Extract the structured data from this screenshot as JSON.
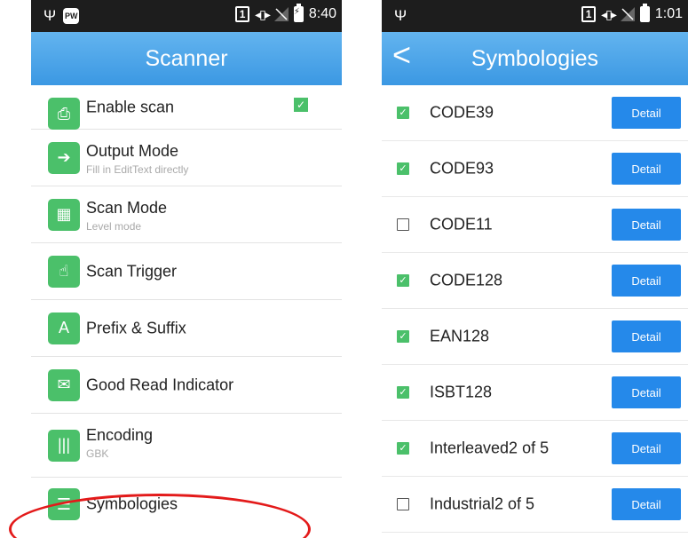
{
  "left": {
    "status": {
      "usb_icon": "usb-icon",
      "notification_icon": "notification-app-icon",
      "sim_badge": "1",
      "time": "8:40"
    },
    "title": "Scanner",
    "items": [
      {
        "title": "Enable scan",
        "subtitle": "",
        "icon": "scan-enable-icon",
        "checked": true
      },
      {
        "title": "Output Mode",
        "subtitle": "Fill in EditText directly",
        "icon": "output-icon"
      },
      {
        "title": "Scan Mode",
        "subtitle": "Level mode",
        "icon": "scan-mode-icon"
      },
      {
        "title": "Scan Trigger",
        "subtitle": "",
        "icon": "trigger-icon"
      },
      {
        "title": "Prefix & Suffix",
        "subtitle": "",
        "icon": "prefix-suffix-icon"
      },
      {
        "title": "Good Read Indicator",
        "subtitle": "",
        "icon": "good-read-icon"
      },
      {
        "title": "Encoding",
        "subtitle": "GBK",
        "icon": "barcode-icon"
      },
      {
        "title": "Symbologies",
        "subtitle": "",
        "icon": "sliders-icon"
      }
    ],
    "highlight_color": "#e31a1a"
  },
  "right": {
    "status": {
      "usb_icon": "usb-icon",
      "sim_badge": "1",
      "time": "1:01"
    },
    "title": "Symbologies",
    "detail_label": "Detail",
    "symbologies": [
      {
        "name": "CODE39",
        "checked": true
      },
      {
        "name": "CODE93",
        "checked": true
      },
      {
        "name": "CODE11",
        "checked": false
      },
      {
        "name": "CODE128",
        "checked": true
      },
      {
        "name": "EAN128",
        "checked": true
      },
      {
        "name": "ISBT128",
        "checked": true
      },
      {
        "name": "Interleaved2 of 5",
        "checked": true
      },
      {
        "name": "Industrial2 of 5",
        "checked": false
      }
    ]
  },
  "colors": {
    "appbar": "#3b98e3",
    "accent_green": "#4bc06a",
    "detail_button": "#2589ea",
    "status_bar": "#1d1d1d"
  }
}
